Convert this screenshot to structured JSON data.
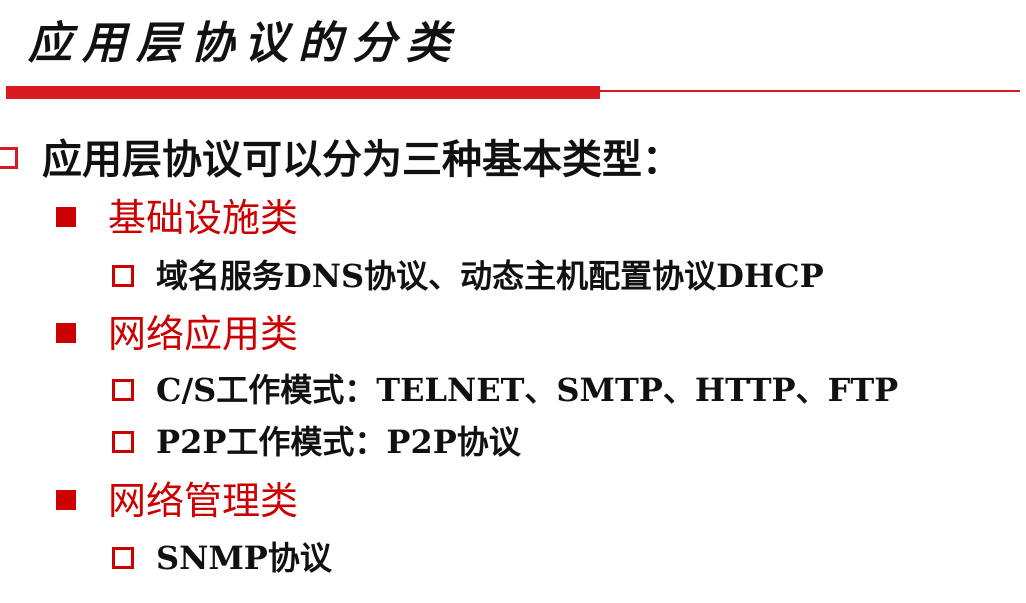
{
  "title": "应用层协议的分类",
  "accent_color": "#d71920",
  "main": {
    "heading": "应用层协议可以分为三种基本类型：",
    "categories": [
      {
        "label": "基础设施类",
        "items": [
          "域名服务DNS协议、动态主机配置协议DHCP"
        ]
      },
      {
        "label": "网络应用类",
        "items": [
          "C/S工作模式：TELNET、SMTP、HTTP、FTP",
          "P2P工作模式：P2P协议"
        ]
      },
      {
        "label": "网络管理类",
        "items": [
          "SNMP协议"
        ]
      }
    ]
  }
}
